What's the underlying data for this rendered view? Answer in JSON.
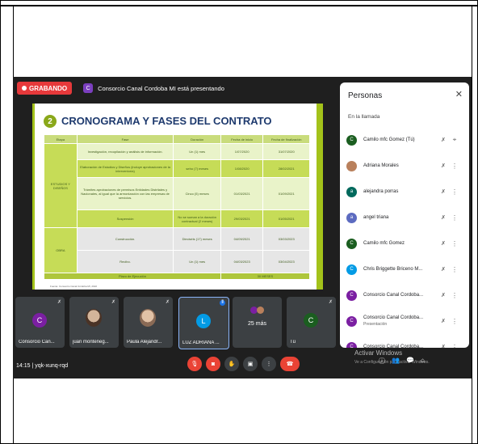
{
  "meet": {
    "recording_label": "GRABANDO",
    "presenter_initial": "C",
    "presenting_text": "Consorcio Canal Cordoba MI está presentando",
    "meeting_time": "14:15",
    "meeting_code": "yqk-xunq-rqd",
    "activate_title": "Activar Windows",
    "activate_sub": "Ve a Configuración para activar Windows."
  },
  "slide": {
    "number": "2",
    "title": "CRONOGRAMA Y FASES DEL CONTRATO",
    "headers": [
      "Etapa",
      "Fase",
      "Duración",
      "Fecha de inicio",
      "Fecha de finalización"
    ],
    "stage_studies": "ESTUDIOS Y DISEÑOS",
    "stage_works": "OBRA",
    "rows": [
      [
        "Investigación, recopilación y análisis de información.",
        "Un (1) mes",
        "1/07/2020",
        "31/07/2020"
      ],
      [
        "Elaboración de Estudios y Diseños (incluye aprobaciones de la interventoría)",
        "seho (7) meses",
        "1/08/2020",
        "28/02/2021"
      ],
      [
        "Trámites aprobaciones de permisos Entidades Distritales y Nacionales, al igual que la armonización con las empresas de servicios.",
        "Cinco (5) meses",
        "01/03/2021",
        "01/09/2021"
      ],
      [
        "Suspensión",
        "No se suman a la duración contractual (2 meses)",
        "29/03/2021",
        "01/05/2021"
      ],
      [
        "Construcción.",
        "Dieciséis (17) meses",
        "04/09/2021",
        "03/03/2023"
      ],
      [
        "Recibo.",
        "Un (1) mes",
        "04/03/2023",
        "03/04/2023"
      ]
    ],
    "total_label": "Plazo de Ejecución",
    "total_value": "30 MESES",
    "source": "Fuente: Consorcio Canal Córdoba MI, 2022"
  },
  "people_panel": {
    "title": "Personas",
    "section": "En la llamada",
    "participants": [
      {
        "initial": "C",
        "color": "#1b5e20",
        "name": "Camilo mfc Gomez (Tú)",
        "sub": ""
      },
      {
        "initial": "",
        "color": "#b9805c",
        "name": "Adriana Morales",
        "sub": ""
      },
      {
        "initial": "a",
        "color": "#00695c",
        "name": "alejandra porras",
        "sub": ""
      },
      {
        "initial": "a",
        "color": "#5c6bc0",
        "name": "angel triana",
        "sub": ""
      },
      {
        "initial": "C",
        "color": "#1b5e20",
        "name": "Camilo mfc Gomez",
        "sub": ""
      },
      {
        "initial": "C",
        "color": "#039be5",
        "name": "Chris Briggette Briceno M...",
        "sub": ""
      },
      {
        "initial": "C",
        "color": "#7b1fa2",
        "name": "Consorcio Canal Cordoba...",
        "sub": ""
      },
      {
        "initial": "C",
        "color": "#7b1fa2",
        "name": "Consorcio Canal Cordoba...",
        "sub": "Presentación"
      },
      {
        "initial": "C",
        "color": "#7b1fa2",
        "name": "Consorcio Canal Cordoba...",
        "sub": ""
      }
    ]
  },
  "tiles": [
    {
      "initial": "C",
      "color": "#7b1fa2",
      "name": "Consorcio Can..."
    },
    {
      "initial": "",
      "color": "",
      "name": "juan monteneg..."
    },
    {
      "initial": "",
      "color": "",
      "name": "Paula Alejandr..."
    },
    {
      "initial": "L",
      "color": "#039be5",
      "name": "LUZ ADRIANA ..."
    },
    {
      "initial": "",
      "color": "",
      "name": "25 más"
    },
    {
      "initial": "C",
      "color": "#1b5e20",
      "name": "Tú"
    }
  ]
}
